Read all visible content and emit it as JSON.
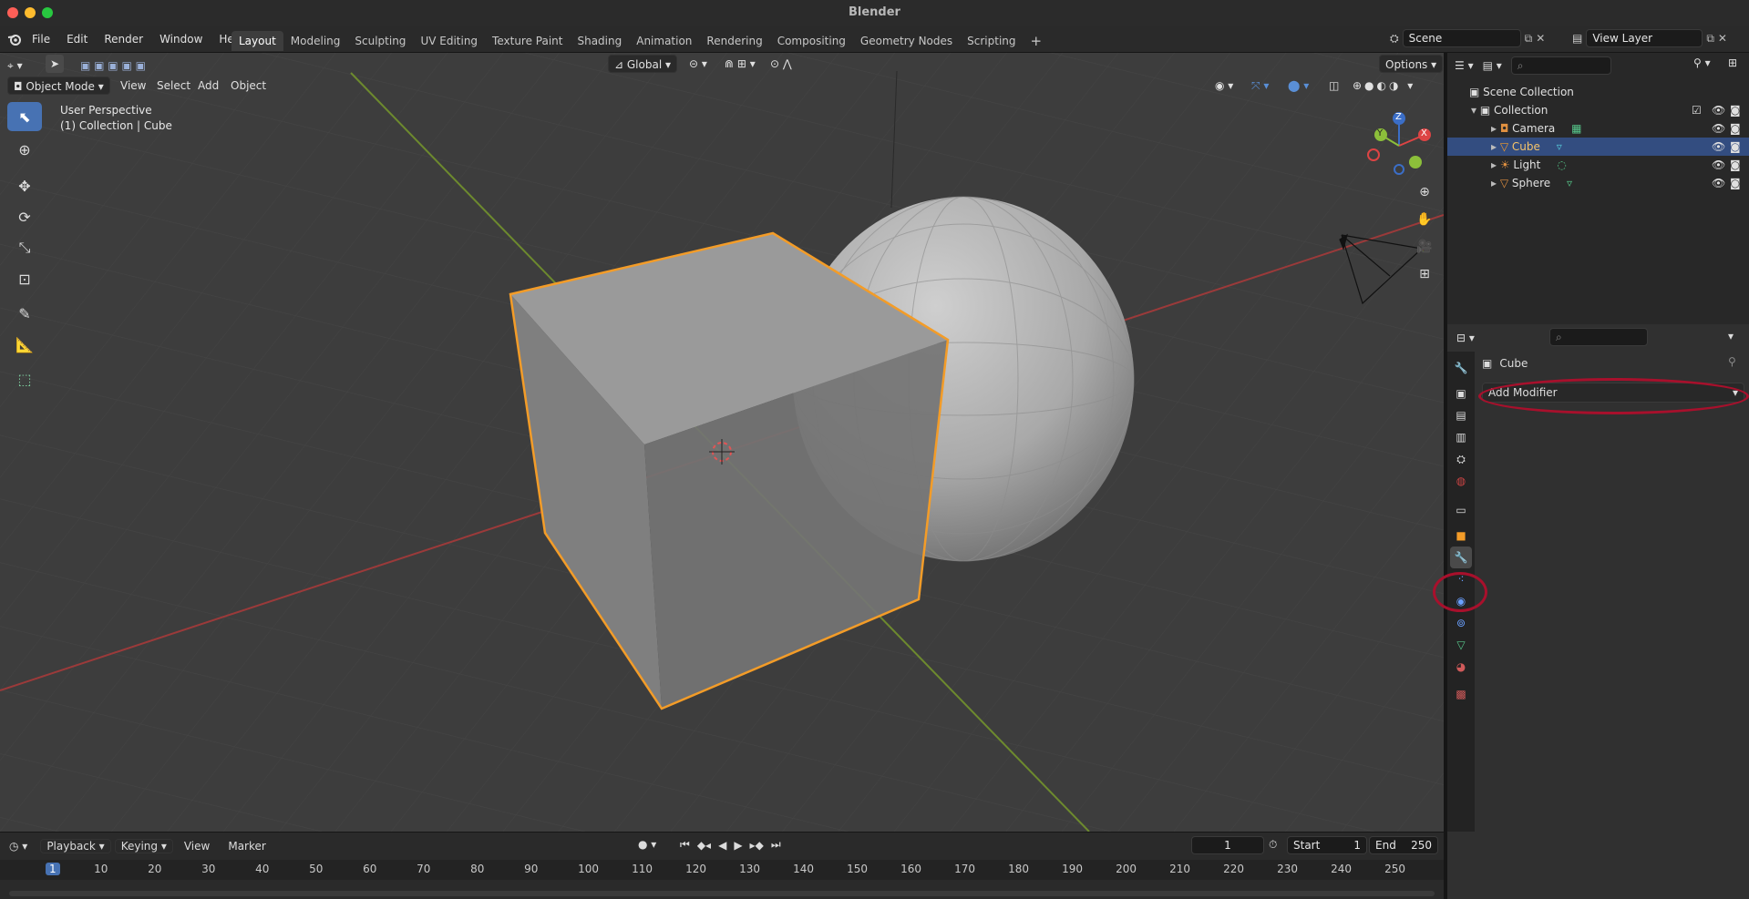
{
  "window": {
    "title": "Blender"
  },
  "menu": [
    "File",
    "Edit",
    "Render",
    "Window",
    "Help"
  ],
  "workspaces": [
    "Layout",
    "Modeling",
    "Sculpting",
    "UV Editing",
    "Texture Paint",
    "Shading",
    "Animation",
    "Rendering",
    "Compositing",
    "Geometry Nodes",
    "Scripting"
  ],
  "active_workspace": "Layout",
  "scene": {
    "name": "Scene",
    "view_layer": "View Layer"
  },
  "viewport": {
    "mode": "Object Mode",
    "menus": [
      "View",
      "Select",
      "Add",
      "Object"
    ],
    "transform_orientation": "Global",
    "options_label": "Options",
    "info_line1": "User Perspective",
    "info_line2": "(1) Collection | Cube",
    "gizmo": {
      "x": "X",
      "y": "Y",
      "z": "Z"
    }
  },
  "outliner": {
    "root": "Scene Collection",
    "collection": "Collection",
    "items": [
      {
        "name": "Camera",
        "selected": false
      },
      {
        "name": "Cube",
        "selected": true
      },
      {
        "name": "Light",
        "selected": false
      },
      {
        "name": "Sphere",
        "selected": false
      }
    ]
  },
  "properties": {
    "object_name": "Cube",
    "add_modifier_label": "Add Modifier",
    "active_tab": "modifier-wrench-icon"
  },
  "timeline": {
    "menus": [
      "Playback",
      "Keying",
      "View",
      "Marker"
    ],
    "current_frame": "1",
    "start_label": "Start",
    "start": "1",
    "end_label": "End",
    "end": "250",
    "ticks": [
      "1",
      "10",
      "20",
      "30",
      "40",
      "50",
      "60",
      "70",
      "80",
      "90",
      "100",
      "110",
      "120",
      "130",
      "140",
      "150",
      "160",
      "170",
      "180",
      "190",
      "200",
      "210",
      "220",
      "230",
      "240",
      "250"
    ]
  },
  "colors": {
    "accent": "#4772b3",
    "selection_outline": "#f39c28",
    "highlight_annotation": "#a8102c"
  }
}
